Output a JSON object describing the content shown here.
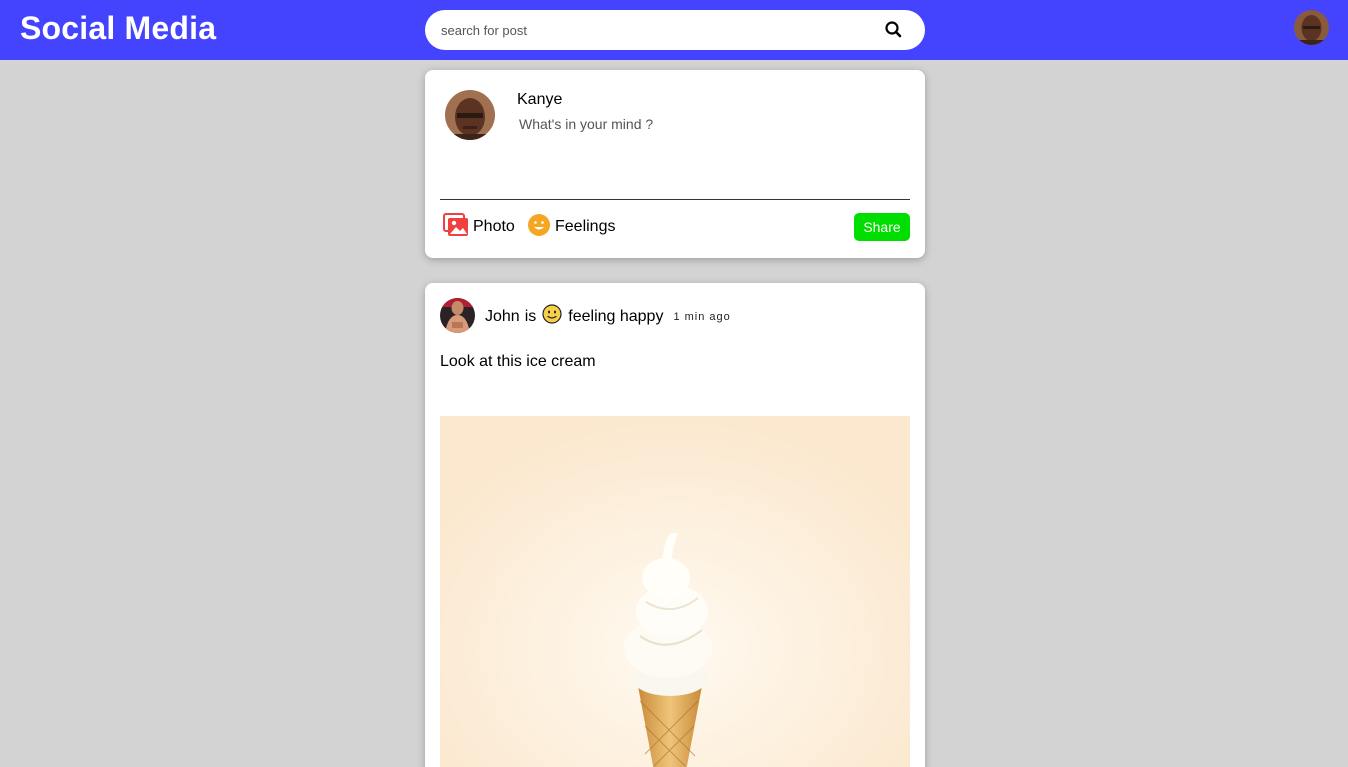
{
  "header": {
    "brand": "Social Media",
    "search_placeholder": "search for post",
    "search_icon": "search-icon",
    "profile_avatar": "user-avatar"
  },
  "composer": {
    "user_name": "Kanye",
    "placeholder": "What's in your mind ?",
    "photo_label": "Photo",
    "photo_icon": "photo-icon",
    "feelings_label": "Feelings",
    "feelings_icon": "smiley-icon",
    "share_label": "Share"
  },
  "post": {
    "author": "John",
    "verb": "is",
    "feeling_icon": "slightly-smiling-face-icon",
    "feeling": "feeling happy",
    "time": "1 min ago",
    "text": "Look at this ice cream",
    "image": "ice-cream-cone"
  },
  "colors": {
    "header_bg": "#4444ff",
    "page_bg": "#d3d3d3",
    "share_button": "#00dd00",
    "photo_icon": "#f04040",
    "feelings_icon": "#f5a623"
  }
}
